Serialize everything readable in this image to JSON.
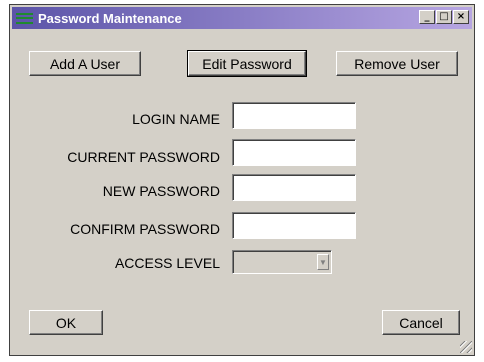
{
  "window": {
    "title": "Password Maintenance",
    "controls": {
      "minimize": "_",
      "maximize": "□",
      "close": "×"
    }
  },
  "toolbar": {
    "add_user": "Add A User",
    "edit_password": "Edit Password",
    "remove_user": "Remove User"
  },
  "form": {
    "login_name_label": "LOGIN NAME",
    "login_name_value": "",
    "current_password_label": "CURRENT PASSWORD",
    "current_password_value": "",
    "new_password_label": "NEW PASSWORD",
    "new_password_value": "",
    "confirm_password_label": "CONFIRM PASSWORD",
    "confirm_password_value": "",
    "access_level_label": "ACCESS LEVEL",
    "access_level_value": "",
    "dropdown_arrow": "▼"
  },
  "footer": {
    "ok": "OK",
    "cancel": "Cancel"
  },
  "colors": {
    "face": "#d4d0c8",
    "title_start": "#5b54a8",
    "title_end": "#b7a6e2"
  }
}
